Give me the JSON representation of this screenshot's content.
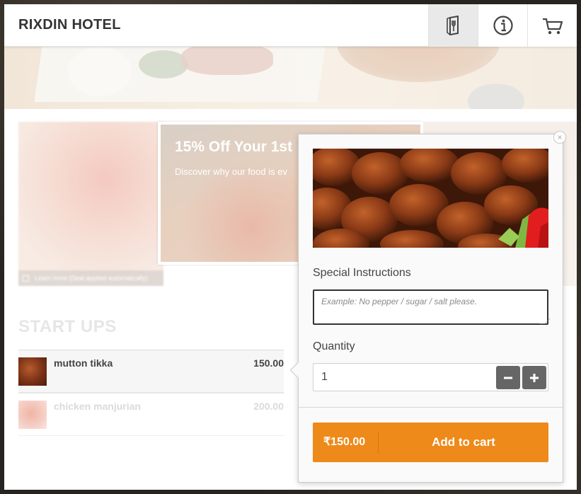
{
  "header": {
    "brand": "RIXDIN HOTEL",
    "buttons": [
      {
        "icon": "menu-utensils-icon",
        "active": true
      },
      {
        "icon": "info-icon",
        "active": false
      },
      {
        "icon": "cart-icon",
        "active": false
      }
    ]
  },
  "promo": {
    "title": "15% Off Your 1st",
    "subtitle": "Discover why our food is ev",
    "learn_more": "Learn more (Deal applied automatically)"
  },
  "menu": {
    "section_title": "START UPS",
    "items": [
      {
        "name": "mutton tikka",
        "price": "150.00",
        "selected": true
      },
      {
        "name": "chicken manjurian",
        "price": "200.00",
        "selected": false
      }
    ]
  },
  "popup": {
    "close_symbol": "×",
    "special_instructions_label": "Special Instructions",
    "special_instructions_placeholder": "Example: No pepper / sugar / salt please.",
    "special_instructions_value": "",
    "quantity_label": "Quantity",
    "quantity_value": "1",
    "total": "₹150.00",
    "add_to_cart_label": "Add to cart"
  },
  "colors": {
    "accent": "#ee8a1a",
    "stepper": "#666666",
    "brand_text": "#333333"
  }
}
